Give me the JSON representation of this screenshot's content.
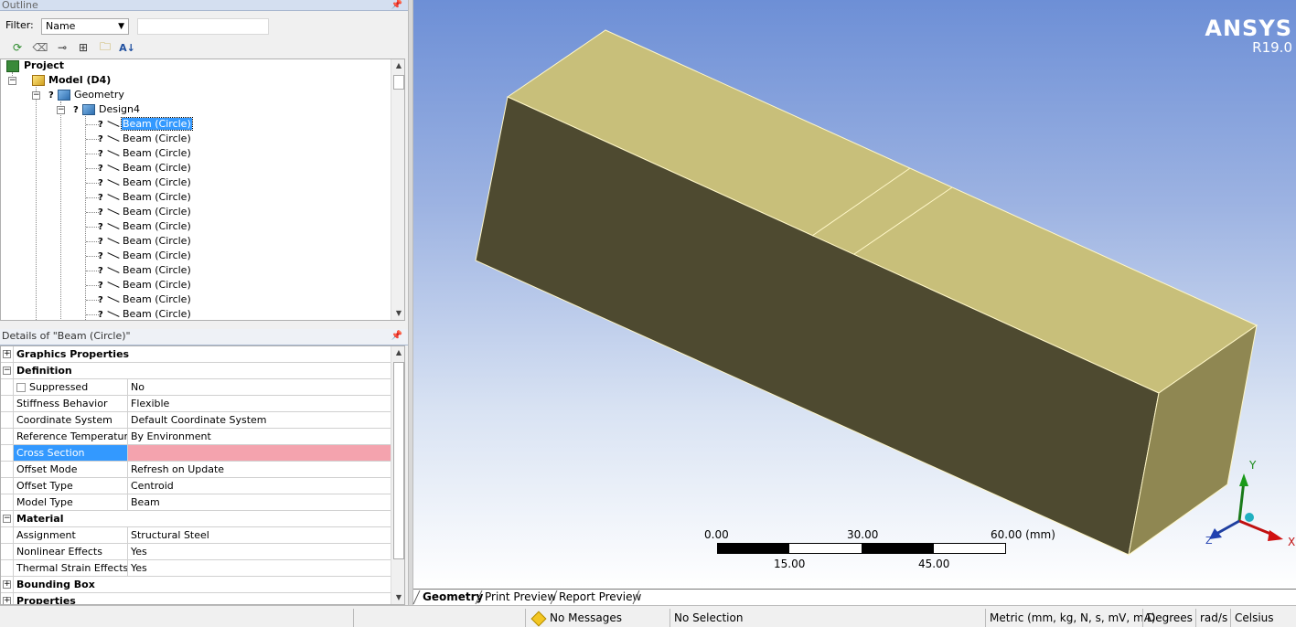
{
  "outline": {
    "title": "Outline",
    "filter_label": "Filter:",
    "filter_value": "Name",
    "filter_text": "",
    "toolbar": [
      "refresh-icon",
      "eraser-icon",
      "tree-expand-icon",
      "expand-all-icon",
      "folder-icon",
      "sort-icon"
    ],
    "tree": {
      "project": "Project",
      "model": "Model (D4)",
      "geometry": "Geometry",
      "design": "Design4",
      "beams": [
        "Beam (Circle)",
        "Beam (Circle)",
        "Beam (Circle)",
        "Beam (Circle)",
        "Beam (Circle)",
        "Beam (Circle)",
        "Beam (Circle)",
        "Beam (Circle)",
        "Beam (Circle)",
        "Beam (Circle)",
        "Beam (Circle)",
        "Beam (Circle)",
        "Beam (Circle)",
        "Beam (Circle)"
      ]
    }
  },
  "details": {
    "title": "Details of \"Beam (Circle)\"",
    "rows": [
      {
        "type": "group",
        "key": "Graphics Properties",
        "expand": "+"
      },
      {
        "type": "group",
        "key": "Definition",
        "expand": "−"
      },
      {
        "type": "prop",
        "key": "Suppressed",
        "value": "No",
        "checkbox": true
      },
      {
        "type": "prop",
        "key": "Stiffness Behavior",
        "value": "Flexible"
      },
      {
        "type": "prop",
        "key": "Coordinate System",
        "value": "Default Coordinate System"
      },
      {
        "type": "prop",
        "key": "Reference Temperature",
        "value": "By Environment"
      },
      {
        "type": "prop",
        "key": "Cross Section",
        "value": "",
        "highlight": true
      },
      {
        "type": "prop",
        "key": "Offset Mode",
        "value": "Refresh on Update"
      },
      {
        "type": "prop",
        "key": "Offset Type",
        "value": "Centroid"
      },
      {
        "type": "prop",
        "key": "Model Type",
        "value": "Beam"
      },
      {
        "type": "group",
        "key": "Material",
        "expand": "−"
      },
      {
        "type": "prop",
        "key": "Assignment",
        "value": "Structural Steel"
      },
      {
        "type": "prop",
        "key": "Nonlinear Effects",
        "value": "Yes"
      },
      {
        "type": "prop",
        "key": "Thermal Strain Effects",
        "value": "Yes"
      },
      {
        "type": "group",
        "key": "Bounding Box",
        "expand": "+"
      },
      {
        "type": "group",
        "key": "Properties",
        "expand": "+"
      }
    ]
  },
  "viewport": {
    "brand": "ANSYS",
    "version": "R19.0",
    "scale": {
      "top_labels": [
        "0.00",
        "30.00",
        "60.00 (mm)"
      ],
      "bottom_labels": [
        "15.00",
        "45.00"
      ]
    },
    "triad": {
      "x": "X",
      "y": "Y",
      "z": "Z"
    },
    "colors": {
      "top_face": "#c8bf7a",
      "front_face": "#4e4a30",
      "end_face": "#8f8752"
    }
  },
  "tabs": [
    "Geometry",
    "Print Preview",
    "Report Preview"
  ],
  "status": {
    "messages": "No Messages",
    "selection": "No Selection",
    "units": "Metric (mm, kg, N, s, mV, mA)",
    "angle": "Degrees",
    "rate": "rad/s",
    "temperature": "Celsius"
  }
}
